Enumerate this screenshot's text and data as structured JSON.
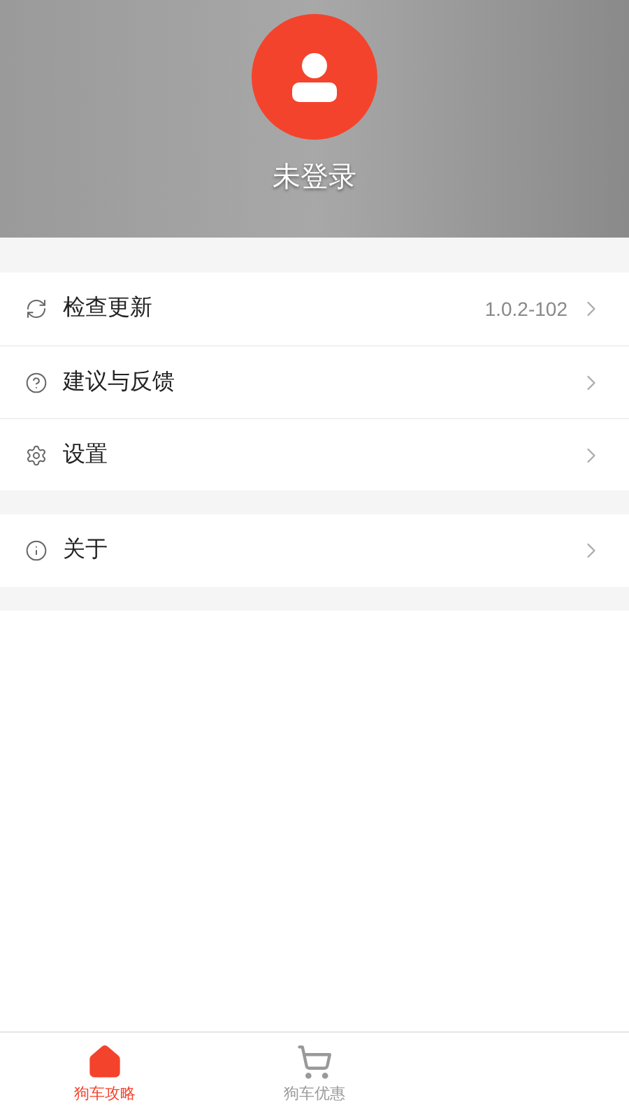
{
  "profile": {
    "name": "未登录"
  },
  "menu_groups": [
    {
      "items": [
        {
          "kind": "refresh",
          "label": "检查更新",
          "value": "1.0.2-102"
        },
        {
          "kind": "help",
          "label": "建议与反馈"
        },
        {
          "kind": "gear",
          "label": "设置"
        }
      ]
    },
    {
      "items": [
        {
          "kind": "info",
          "label": "关于"
        }
      ]
    }
  ],
  "tabs": [
    {
      "kind": "home",
      "label": "狗车攻略",
      "selected": true
    },
    {
      "kind": "cart",
      "label": "狗车优惠",
      "selected": false
    }
  ]
}
